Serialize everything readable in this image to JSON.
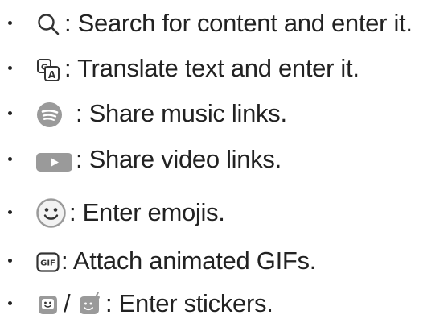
{
  "items": [
    {
      "icon": "search-icon",
      "text": ": Search for content and enter it."
    },
    {
      "icon": "translate-icon",
      "text": ": Translate text and enter it."
    },
    {
      "icon": "spotify-icon",
      "text": ": Share music links."
    },
    {
      "icon": "youtube-icon",
      "text": ": Share video links."
    },
    {
      "icon": "emoji-icon",
      "text": ": Enter emojis."
    },
    {
      "icon": "gif-icon",
      "text": ": Attach animated GIFs."
    },
    {
      "icons": [
        "sticker-icon",
        "animated-sticker-icon"
      ],
      "separator": "/",
      "text": ": Enter stickers."
    }
  ],
  "colors": {
    "text": "#222222",
    "icon_fill": "#9a9a9a",
    "icon_stroke": "#333333"
  }
}
